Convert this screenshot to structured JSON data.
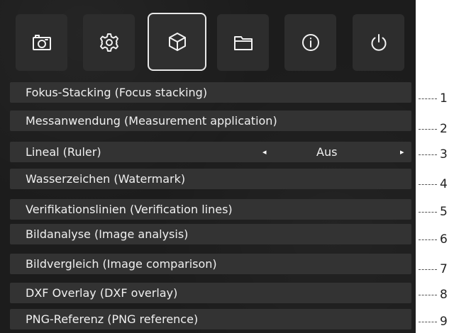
{
  "tabs": [
    {
      "icon": "camera-icon",
      "active": false
    },
    {
      "icon": "gear-icon",
      "active": false
    },
    {
      "icon": "cube-icon",
      "active": true
    },
    {
      "icon": "folder-icon",
      "active": false
    },
    {
      "icon": "info-icon",
      "active": false
    },
    {
      "icon": "power-icon",
      "active": false
    }
  ],
  "menu": {
    "items": [
      {
        "label": "Fokus-Stacking (Focus stacking)"
      },
      {
        "label": "Messanwendung (Measurement application)"
      },
      {
        "label": "Lineal (Ruler)",
        "value": "Aus",
        "arrow_left": "◂",
        "arrow_right": "▸"
      },
      {
        "label": "Wasserzeichen (Watermark)"
      },
      {
        "label": "Verifikationslinien (Verification lines)"
      },
      {
        "label": "Bildanalyse (Image analysis)"
      },
      {
        "label": "Bildvergleich (Image comparison)"
      },
      {
        "label": "DXF Overlay (DXF overlay)"
      },
      {
        "label": "PNG-Referenz (PNG reference)"
      }
    ]
  },
  "callouts": [
    "1",
    "2",
    "3",
    "4",
    "5",
    "6",
    "7",
    "8",
    "9"
  ],
  "colors": {
    "panel_background": "#1c1c1c",
    "row_background": "#333333",
    "tab_background": "#2d2d2d",
    "active_tab_border": "#e8e8e8",
    "text": "#f0f0f0"
  }
}
